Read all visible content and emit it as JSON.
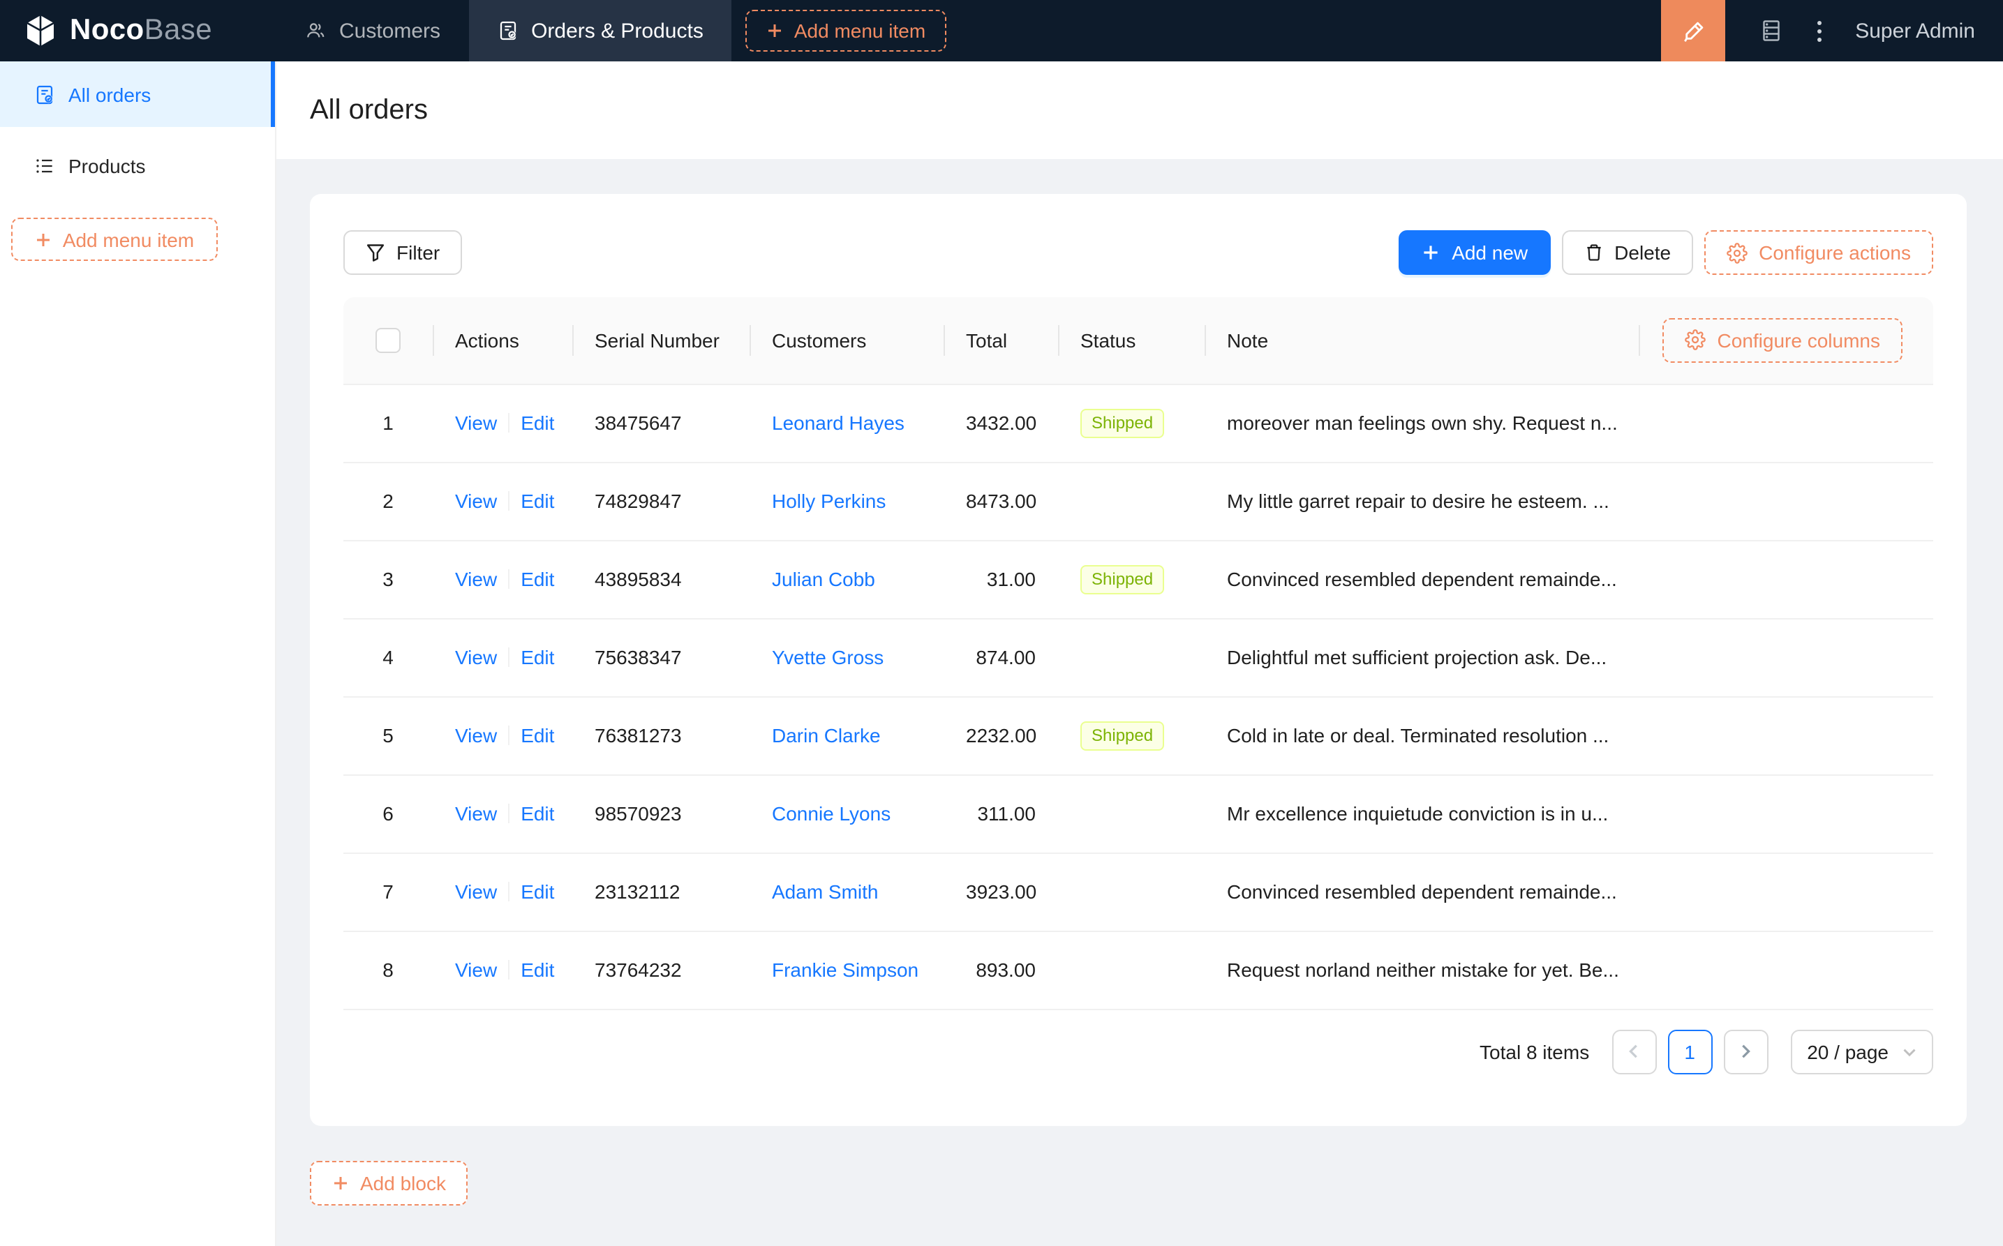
{
  "navbar": {
    "logo_primary": "Noco",
    "logo_secondary": "Base",
    "menu_items": [
      {
        "label": "Customers",
        "icon": "team-icon",
        "active": false
      },
      {
        "label": "Orders & Products",
        "icon": "order-check-icon",
        "active": true
      }
    ],
    "add_menu_item_label": "Add menu item",
    "user_name": "Super Admin"
  },
  "sidebar": {
    "items": [
      {
        "label": "All orders",
        "icon": "order-check-icon",
        "selected": true
      },
      {
        "label": "Products",
        "icon": "list-icon",
        "selected": false
      }
    ],
    "add_menu_item_label": "Add menu item"
  },
  "page": {
    "title": "All orders"
  },
  "toolbar": {
    "filter_label": "Filter",
    "add_new_label": "Add new",
    "delete_label": "Delete",
    "configure_actions_label": "Configure actions"
  },
  "table": {
    "configure_columns_label": "Configure columns",
    "columns": [
      "Actions",
      "Serial Number",
      "Customers",
      "Total",
      "Status",
      "Note"
    ],
    "action_labels": {
      "view": "View",
      "edit": "Edit"
    },
    "rows": [
      {
        "index": 1,
        "serial": "38475647",
        "customer": "Leonard Hayes",
        "total": "3432.00",
        "status": "Shipped",
        "note": "moreover man feelings own shy. Request n..."
      },
      {
        "index": 2,
        "serial": "74829847",
        "customer": "Holly Perkins",
        "total": "8473.00",
        "status": "",
        "note": "My little garret repair to desire he esteem. ..."
      },
      {
        "index": 3,
        "serial": "43895834",
        "customer": "Julian Cobb",
        "total": "31.00",
        "status": "Shipped",
        "note": "Convinced resembled dependent remainde..."
      },
      {
        "index": 4,
        "serial": "75638347",
        "customer": "Yvette Gross",
        "total": "874.00",
        "status": "",
        "note": "Delightful met sufficient projection ask. De..."
      },
      {
        "index": 5,
        "serial": "76381273",
        "customer": "Darin Clarke",
        "total": "2232.00",
        "status": "Shipped",
        "note": "Cold in late or deal. Terminated resolution ..."
      },
      {
        "index": 6,
        "serial": "98570923",
        "customer": "Connie Lyons",
        "total": "311.00",
        "status": "",
        "note": "Mr excellence inquietude conviction is in u..."
      },
      {
        "index": 7,
        "serial": "23132112",
        "customer": "Adam Smith",
        "total": "3923.00",
        "status": "",
        "note": "Convinced resembled dependent remainde..."
      },
      {
        "index": 8,
        "serial": "73764232",
        "customer": "Frankie Simpson",
        "total": "893.00",
        "status": "",
        "note": "Request norland neither mistake for yet. Be..."
      }
    ]
  },
  "pagination": {
    "total_text": "Total 8 items",
    "current_page": "1",
    "page_size_text": "20 / page"
  },
  "add_block_label": "Add block",
  "colors": {
    "accent_orange": "#f18b62",
    "designer_button_orange": "#ee8a5c",
    "primary_blue": "#1677ff",
    "navbar_bg": "#0d1b2b",
    "navbar_active_tab_bg": "#263345",
    "selected_menu_bg": "#e6f4ff",
    "content_bg": "#f0f2f5",
    "tag_lime_bg": "#fcffe6",
    "tag_lime_border": "#eaff8f",
    "tag_lime_text": "#7cb305"
  }
}
